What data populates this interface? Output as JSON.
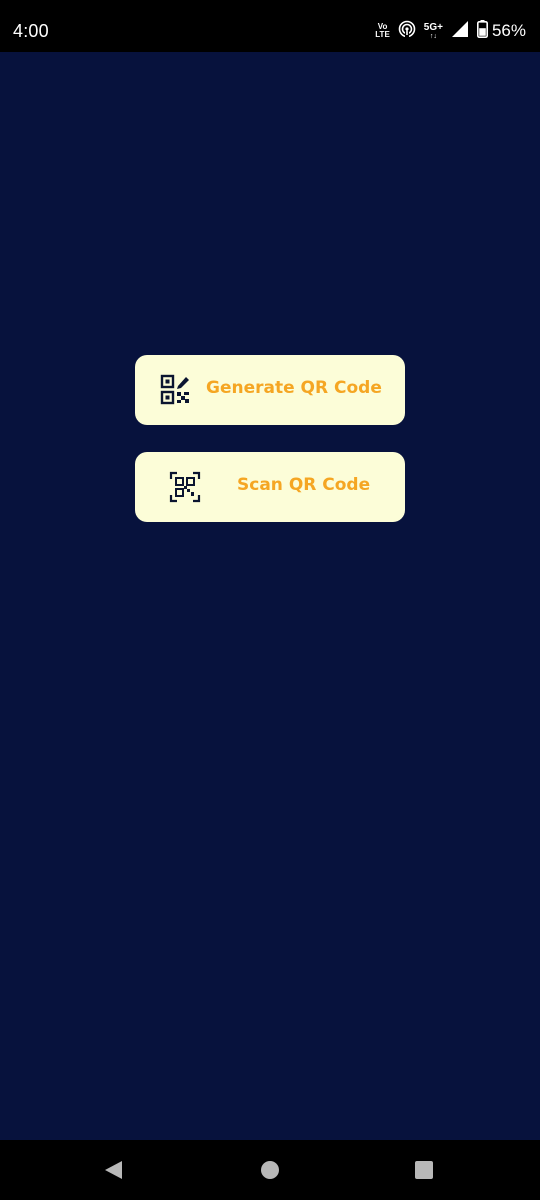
{
  "status_bar": {
    "time": "4:00",
    "volte_top": "Vo",
    "volte_bottom": "LTE",
    "network": "5G+",
    "network_arrows": "↑↓",
    "battery_percent": "56%",
    "icons": [
      "volte-icon",
      "hotspot-icon",
      "signal-icon",
      "battery-icon"
    ]
  },
  "main": {
    "buttons": [
      {
        "label": "Generate QR Code",
        "icon": "qr-edit-icon"
      },
      {
        "label": "Scan QR Code",
        "icon": "qr-scan-icon"
      }
    ]
  },
  "nav_bar": {
    "items": [
      "back-icon",
      "home-icon",
      "recents-icon"
    ]
  },
  "colors": {
    "background": "#07123d",
    "button_bg": "#fcfdd8",
    "button_text": "#f5a623",
    "icon": "#0b1530",
    "bars": "#000000"
  }
}
